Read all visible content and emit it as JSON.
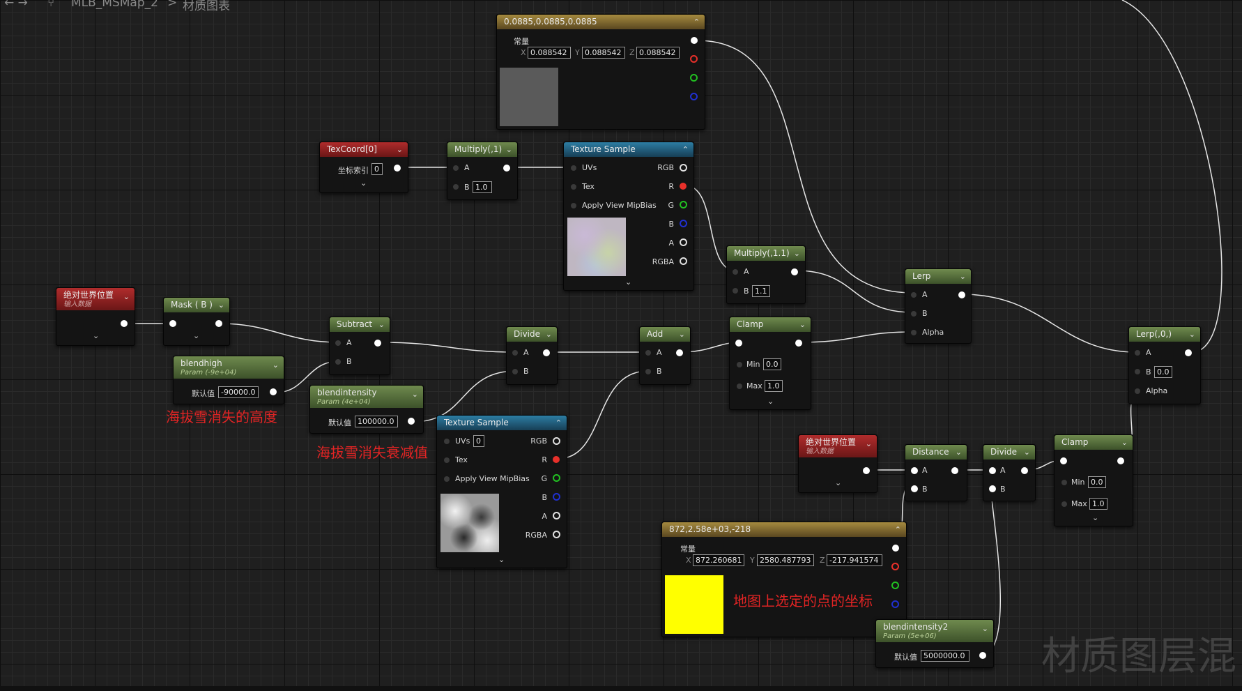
{
  "breadcrumb": {
    "material": "MLB_MSMap_2",
    "separator": ">",
    "graph": "材质图表"
  },
  "nodes": {
    "const3": {
      "title": "0.0885,0.0885,0.0885",
      "label": "常量",
      "x_label": "X",
      "y_label": "Y",
      "z_label": "Z",
      "x": "0.088542",
      "y": "0.088542",
      "z": "0.088542",
      "swatch_color": "#5a5a5a"
    },
    "texcoord": {
      "title": "TexCoord[0]",
      "field_label": "坐标索引",
      "value": "0"
    },
    "multiply1": {
      "title": "Multiply(,1)",
      "pin_a": "A",
      "pin_b": "B",
      "b_value": "1.0"
    },
    "texsample1": {
      "title": "Texture Sample",
      "uvs": "UVs",
      "tex": "Tex",
      "mip": "Apply View MipBias",
      "out_rgb": "RGB",
      "out_r": "R",
      "out_g": "G",
      "out_b": "B",
      "out_a": "A",
      "out_rgba": "RGBA"
    },
    "multiply11": {
      "title": "Multiply(,1.1)",
      "pin_a": "A",
      "pin_b": "B",
      "b_value": "1.1"
    },
    "lerp": {
      "title": "Lerp",
      "pin_a": "A",
      "pin_b": "B",
      "pin_alpha": "Alpha"
    },
    "absworld1": {
      "title": "绝对世界位置",
      "sub": "输入数据"
    },
    "mask": {
      "title": "Mask ( B )"
    },
    "subtract": {
      "title": "Subtract",
      "pin_a": "A",
      "pin_b": "B"
    },
    "divide1": {
      "title": "Divide",
      "pin_a": "A",
      "pin_b": "B"
    },
    "add": {
      "title": "Add",
      "pin_a": "A",
      "pin_b": "B"
    },
    "clamp1": {
      "title": "Clamp",
      "min_label": "Min",
      "min": "0.0",
      "max_label": "Max",
      "max": "1.0"
    },
    "lerp0": {
      "title": "Lerp(,0,)",
      "pin_a": "A",
      "pin_b": "B",
      "b_value": "0.0",
      "pin_alpha": "Alpha"
    },
    "blendhigh": {
      "title": "blendhigh",
      "sub": "Param (-9e+04)",
      "field_label": "默认值",
      "value": "-90000.0"
    },
    "blendintensity": {
      "title": "blendintensity",
      "sub": "Param (4e+04)",
      "field_label": "默认值",
      "value": "100000.0"
    },
    "texsample2": {
      "title": "Texture Sample",
      "uvs": "UVs",
      "uvs_value": "0",
      "tex": "Tex",
      "mip": "Apply View MipBias",
      "out_rgb": "RGB",
      "out_r": "R",
      "out_g": "G",
      "out_b": "B",
      "out_a": "A",
      "out_rgba": "RGBA"
    },
    "absworld2": {
      "title": "绝对世界位置",
      "sub": "输入数据"
    },
    "distance": {
      "title": "Distance",
      "pin_a": "A",
      "pin_b": "B"
    },
    "divide2": {
      "title": "Divide",
      "pin_a": "A",
      "pin_b": "B"
    },
    "clamp2": {
      "title": "Clamp",
      "min_label": "Min",
      "min": "0.0",
      "max_label": "Max",
      "max": "1.0"
    },
    "const3b": {
      "title": "872,2.58e+03,-218",
      "label": "常量",
      "x_label": "X",
      "y_label": "Y",
      "z_label": "Z",
      "x": "872.260681",
      "y": "2580.487793",
      "z": "-217.941574",
      "swatch_color": "#ffff00"
    },
    "blendintensity2": {
      "title": "blendintensity2",
      "sub": "Param (5e+06)",
      "field_label": "默认值",
      "value": "5000000.0"
    }
  },
  "annotations": {
    "a1": "海拔雪消失的高度",
    "a2": "海拔雪消失衰减值",
    "a3": "地图上选定的点的坐标"
  },
  "watermark": "材质图层混",
  "colors": {
    "param_header": "#6f8a4e",
    "expr_header": "#2d7da3",
    "input_header": "#b02c2c",
    "const_header": "#a58a3f",
    "annotation": "#e02424"
  }
}
